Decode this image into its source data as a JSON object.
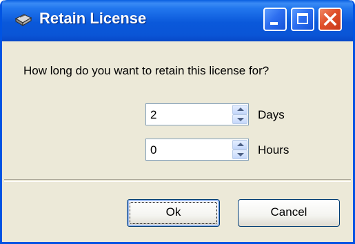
{
  "window": {
    "title": "Retain License",
    "app_icon": "license-icon",
    "controls": {
      "minimize_icon": "minimize-icon",
      "maximize_icon": "maximize-icon",
      "close_icon": "close-icon"
    }
  },
  "dialog": {
    "question": "How long do you want to retain this license for?",
    "days": {
      "value": "2",
      "label": "Days"
    },
    "hours": {
      "value": "0",
      "label": "Hours"
    },
    "ok_label": "Ok",
    "cancel_label": "Cancel"
  },
  "colors": {
    "title_bar": "#0a58da",
    "close_button": "#e0502a",
    "dialog_background": "#ece9d8",
    "button_border": "#003c74"
  }
}
